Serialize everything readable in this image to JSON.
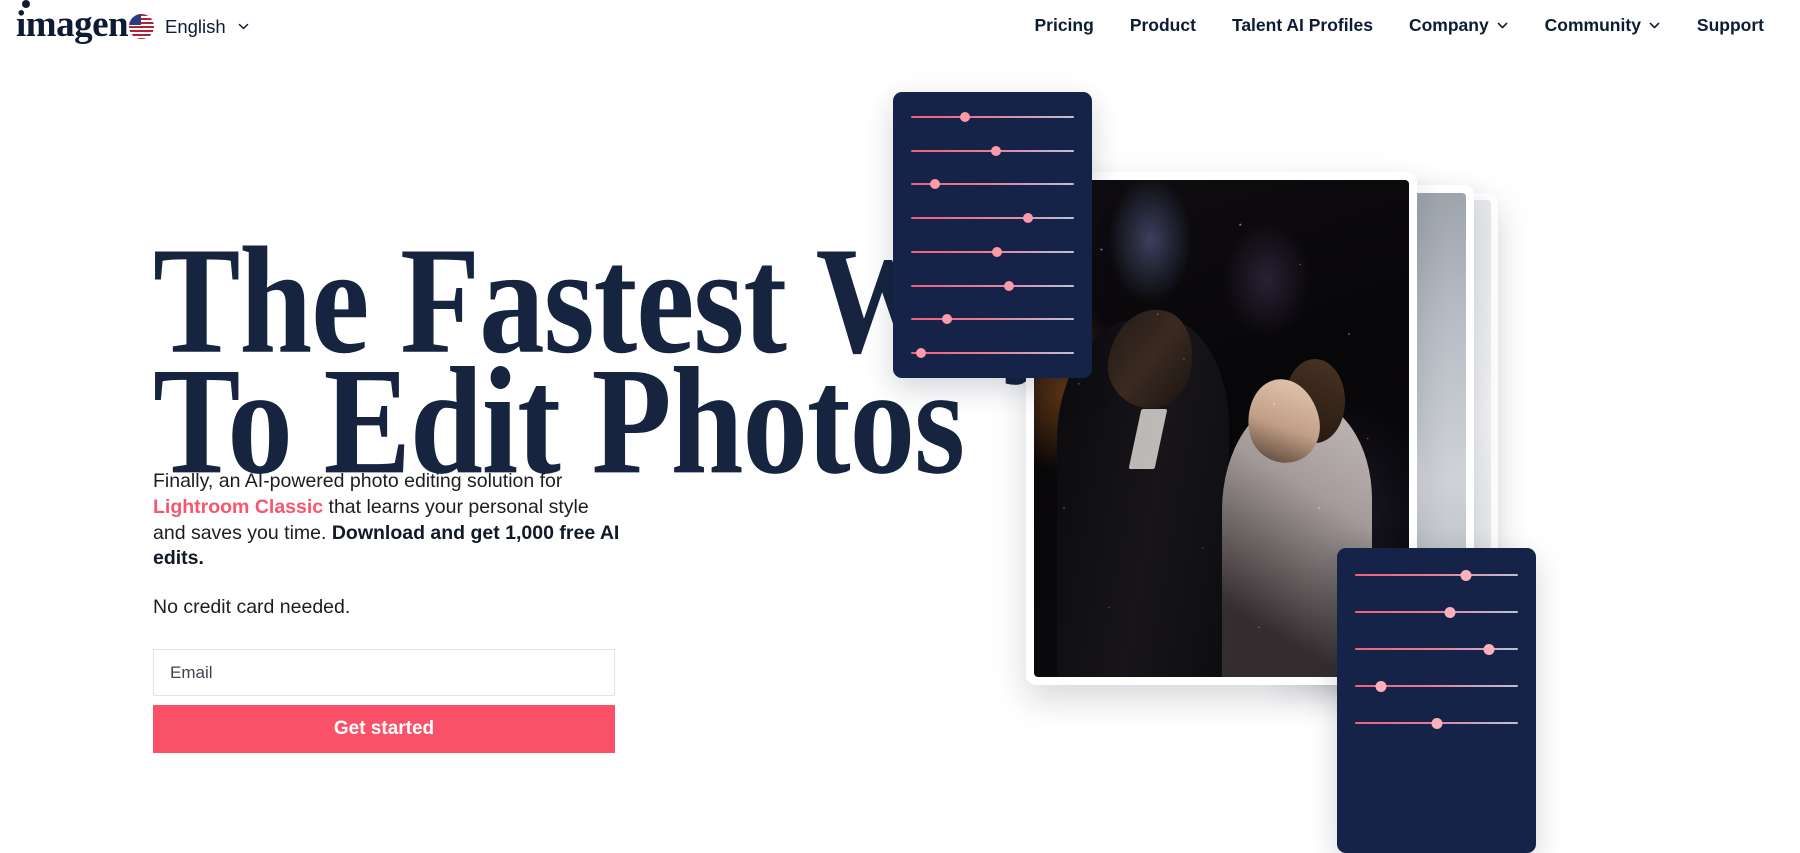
{
  "header": {
    "logo_text": "imagen",
    "logo_icon": "imagen-wordmark",
    "language": {
      "label": "English",
      "flag_icon": "us-flag-icon",
      "chevron_icon": "chevron-down-icon"
    },
    "nav": [
      {
        "label": "Pricing",
        "has_dropdown": false
      },
      {
        "label": "Product",
        "has_dropdown": false
      },
      {
        "label": "Talent AI Profiles",
        "has_dropdown": false
      },
      {
        "label": "Company",
        "has_dropdown": true
      },
      {
        "label": "Community",
        "has_dropdown": true
      },
      {
        "label": "Support",
        "has_dropdown": false
      }
    ]
  },
  "hero": {
    "headline_line1": "The Fastest Way",
    "headline_line2": "To Edit Photos",
    "sub_part1": "Finally, an AI-powered photo editing solution for ",
    "sub_link": "Lightroom Classic",
    "sub_part2": " that learns your personal style and saves you time. ",
    "sub_bold": "Download and get 1,000 free AI edits.",
    "no_credit": "No credit card needed.",
    "email_placeholder": "Email",
    "email_value": "",
    "cta_label": "Get started"
  },
  "colors": {
    "brand_pink": "#fa5068",
    "link_pink": "#f7566e",
    "headline_navy": "#16243f",
    "panel_navy": "#142347",
    "slider_thumb": "#fb9aa8",
    "page_background": "#ffffff"
  },
  "visual": {
    "panel_top": {
      "name": "slider-panel-top",
      "slider_count": 8,
      "slider_positions_pct": [
        33,
        52,
        15,
        72,
        53,
        60,
        22,
        6
      ]
    },
    "panel_bottom": {
      "name": "slider-panel-bottom",
      "slider_count": 5,
      "slider_positions_pct": [
        68,
        58,
        82,
        16,
        50
      ]
    },
    "photo_cards": [
      {
        "name": "photo-card-main",
        "subject": "wedding-couple-night-photo"
      },
      {
        "name": "photo-card-back1",
        "subject": "bride-portrait-photo"
      },
      {
        "name": "photo-card-back2",
        "subject": "blank-photo"
      }
    ]
  }
}
